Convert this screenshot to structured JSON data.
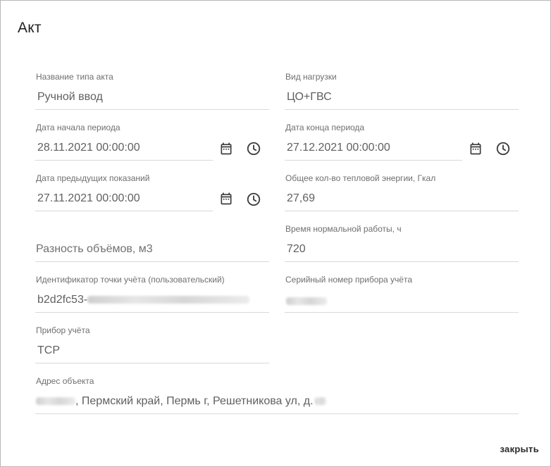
{
  "dialog": {
    "title": "Акт",
    "close_label": "закрыть"
  },
  "fields": {
    "act_type": {
      "label": "Название типа акта",
      "value": "Ручной ввод"
    },
    "load_type": {
      "label": "Вид нагрузки",
      "value": "ЦО+ГВС"
    },
    "period_start": {
      "label": "Дата начала периода",
      "value": "28.11.2021 00:00:00"
    },
    "period_end": {
      "label": "Дата конца периода",
      "value": "27.12.2021 00:00:00"
    },
    "prev_readings_date": {
      "label": "Дата предыдущих показаний",
      "value": "27.11.2021 00:00:00"
    },
    "total_heat": {
      "label": "Общее кол-во тепловой энергии, Гкал",
      "value": "27,69"
    },
    "volume_diff": {
      "placeholder": "Разность объёмов, м3"
    },
    "normal_hours": {
      "label": "Время нормальной работы, ч",
      "value": "720"
    },
    "point_id": {
      "label": "Идентификатор точки учёта (пользовательский)",
      "value_prefix": "b2d2fc53-"
    },
    "meter_serial": {
      "label": "Серийный номер прибора учёта"
    },
    "meter": {
      "label": "Прибор учёта",
      "value": "ТСР"
    },
    "address": {
      "label": "Адрес объекта",
      "value_middle": ", Пермский край, Пермь г, Решетникова ул, д."
    }
  },
  "icons": {
    "calendar": "calendar-icon",
    "clock": "clock-icon"
  }
}
